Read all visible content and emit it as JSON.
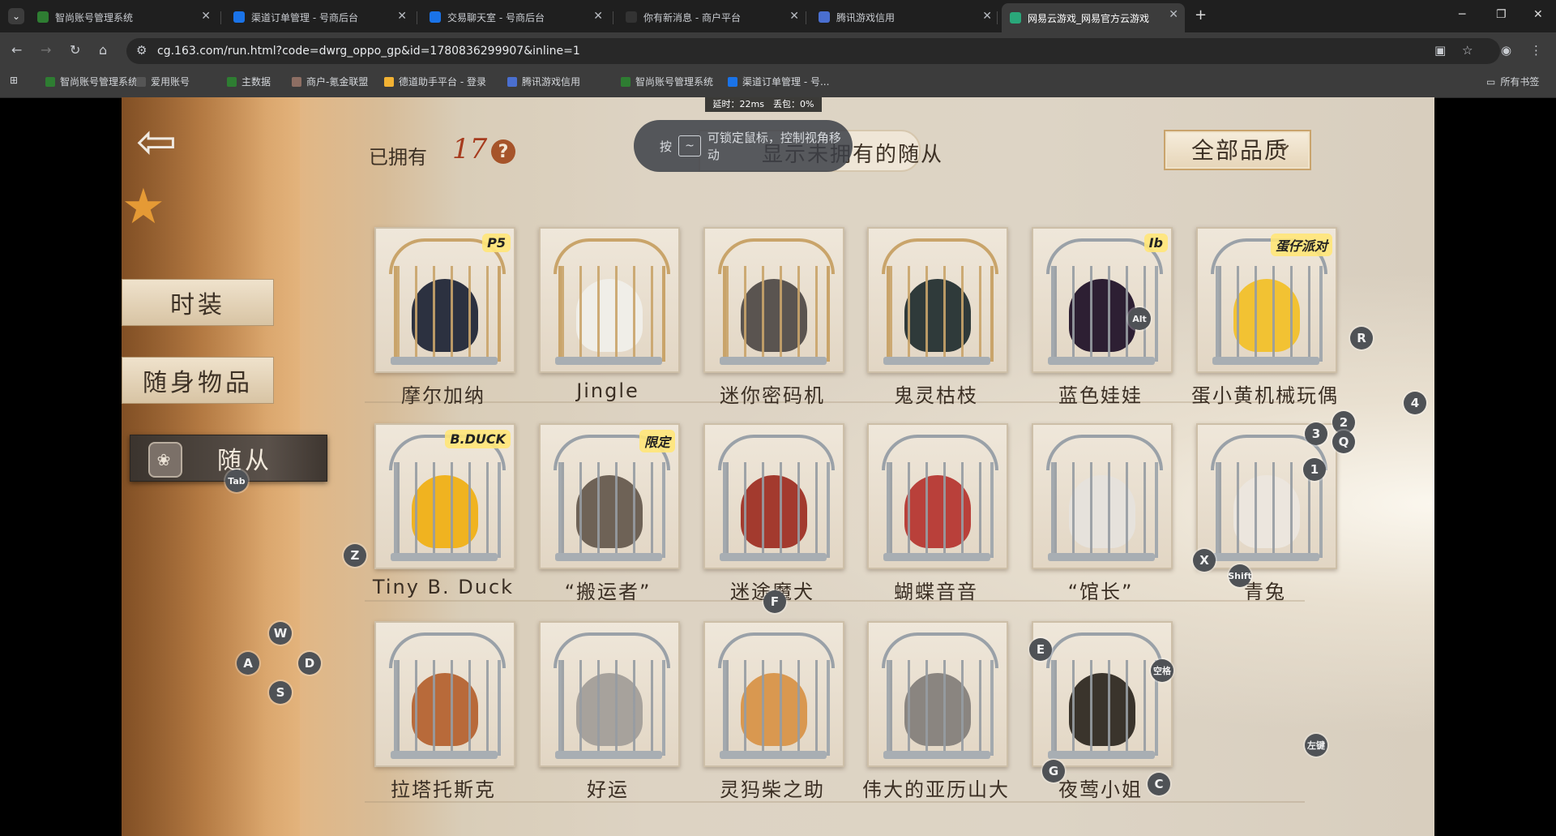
{
  "browser": {
    "tabs": [
      {
        "title": "智尚账号管理系统",
        "color": "#2e7d32"
      },
      {
        "title": "渠道订单管理 - 号商后台",
        "color": "#1a73e8"
      },
      {
        "title": "交易聊天室 - 号商后台",
        "color": "#1a73e8"
      },
      {
        "title": "你有新消息 - 商户平台",
        "color": "#333333"
      },
      {
        "title": "腾讯游戏信用",
        "color": "#4a6fd0"
      },
      {
        "title": "网易云游戏_网易官方云游戏",
        "color": "#2aa87a"
      }
    ],
    "new_tab_label": "+",
    "url": "cg.163.com/run.html?code=dwrg_oppo_gp&id=1780836299907&inline=1",
    "bookmarks": [
      {
        "label": "智尚账号管理系统",
        "color": "#2e7d32"
      },
      {
        "label": "爱用账号",
        "color": "#555555"
      },
      {
        "label": "主数据",
        "color": "#2e7d32"
      },
      {
        "label": "商户-氪金联盟",
        "color": "#8d6e63"
      },
      {
        "label": "德道助手平台 - 登录",
        "color": "#f2b233"
      },
      {
        "label": "腾讯游戏信用",
        "color": "#4a6fd0"
      },
      {
        "label": "智尚账号管理系统",
        "color": "#2e7d32"
      },
      {
        "label": "渠道订单管理 - 号...",
        "color": "#1a73e8"
      }
    ],
    "all_bookmarks": "所有书签"
  },
  "overlay": {
    "latency": "延时：22ms　丢包：0%",
    "lock_hint_prefix": "按",
    "lock_hint_key": "~",
    "lock_hint_text": "可锁定鼠标，控制视角移动"
  },
  "game": {
    "owned_label": "已拥有",
    "owned_count": "17",
    "help": "?",
    "filter_label": "显示未拥有的随从",
    "quality_label": "全部品质",
    "side_menu": [
      {
        "label": "时装"
      },
      {
        "label": "随身物品"
      },
      {
        "label": "随从",
        "active": true
      }
    ],
    "cards": [
      {
        "name": "摩尔加纳",
        "tag": "P5",
        "color": "#2c3140",
        "gold": true
      },
      {
        "name": "Jingle",
        "tag": "",
        "color": "#f0eee8",
        "gold": true
      },
      {
        "name": "迷你密码机",
        "tag": "",
        "color": "#5a5450",
        "gold": true
      },
      {
        "name": "鬼灵枯枝",
        "tag": "",
        "color": "#2f3a3a",
        "gold": true
      },
      {
        "name": "蓝色娃娃",
        "tag": "Ib",
        "color": "#2d1f33",
        "gold": false
      },
      {
        "name": "蛋小黄机械玩偶",
        "tag": "蛋仔派对",
        "color": "#f2c233",
        "gold": false
      },
      {
        "name": "Tiny B. Duck",
        "tag": "B.DUCK",
        "color": "#f0b320",
        "gold": false
      },
      {
        "name": "“搬运者”",
        "tag": "限定",
        "color": "#6e6256",
        "gold": false
      },
      {
        "name": "迷途魔犬",
        "tag": "",
        "color": "#a33a2e",
        "gold": false
      },
      {
        "name": "蝴蝶音音",
        "tag": "",
        "color": "#b9403a",
        "gold": false
      },
      {
        "name": "“馆长”",
        "tag": "",
        "color": "#e6e2dc",
        "gold": false
      },
      {
        "name": "青兔",
        "tag": "",
        "color": "#ece6de",
        "gold": false
      },
      {
        "name": "拉塔托斯克",
        "tag": "",
        "color": "#b86a3a",
        "gold": false
      },
      {
        "name": "好运",
        "tag": "",
        "color": "#a7a29c",
        "gold": false
      },
      {
        "name": "灵犸柴之助",
        "tag": "",
        "color": "#d99850",
        "gold": false
      },
      {
        "name": "伟大的亚历山大",
        "tag": "",
        "color": "#8a8580",
        "gold": false
      },
      {
        "name": "夜莺小姐",
        "tag": "",
        "color": "#3a342c",
        "gold": false
      }
    ],
    "hotkeys": [
      "Tab",
      "Alt",
      "R",
      "4",
      "2",
      "3",
      "Q",
      "1",
      "X",
      "Shift",
      "Z",
      "F",
      "W",
      "A",
      "D",
      "S",
      "E",
      "空格",
      "G",
      "C",
      "左键"
    ]
  }
}
